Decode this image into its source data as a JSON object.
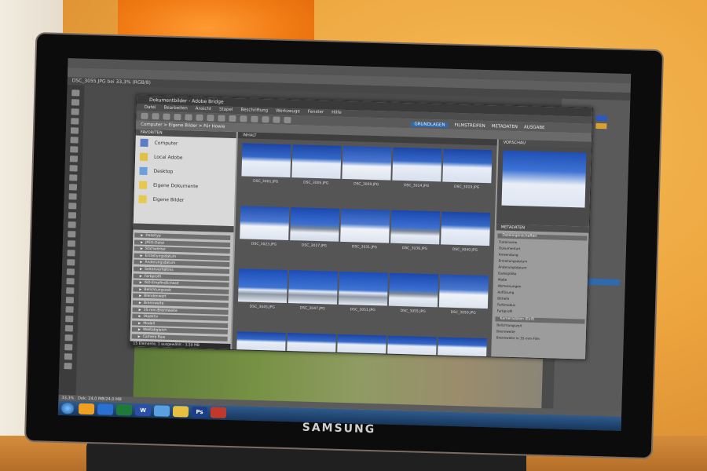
{
  "monitor": {
    "brand": "SAMSUNG"
  },
  "bridge": {
    "title": "Dokumentbilder - Adobe Bridge",
    "menu": [
      "Datei",
      "Bearbeiten",
      "Ansicht",
      "Stapel",
      "Beschriftung",
      "Werkzeuge",
      "Fenster",
      "Hilfe"
    ],
    "path": "Computer > Eigene Bilder > Für Howie",
    "workspaces": [
      {
        "label": "GRUNDLAGEN",
        "active": true
      },
      {
        "label": "FILMSTREIFEN",
        "active": false
      },
      {
        "label": "METADATEN",
        "active": false
      },
      {
        "label": "AUSGABE",
        "active": false
      }
    ],
    "favorites_tab": "FAVORITEN",
    "favorites": [
      "Computer",
      "Local Adobe",
      "Desktop",
      "Eigene Dokumente",
      "Eigene Bilder"
    ],
    "filter_tabs": [
      "FILTER",
      "SAMMLUNGEN",
      "EXPORTIEREN"
    ],
    "filter_items": [
      "Dateityp",
      "JPEG-Datei",
      "Stichwörter",
      "Erstellungsdatum",
      "Änderungsdatum",
      "Seitenverhältnis",
      "Farbprofil",
      "ISO-Empfindlichkeit",
      "Belichtungszeit",
      "Blendenwert",
      "Brennweite",
      "35-mm-Brennweite",
      "Objektiv",
      "Modell",
      "Weißabgleich",
      "Camera Raw"
    ],
    "content_tab": "INHALT",
    "thumbnails": [
      {
        "label": "DSC_3001.JPG",
        "type": "snow"
      },
      {
        "label": "DSC_3005.JPG",
        "type": "snow"
      },
      {
        "label": "DSC_3009.JPG",
        "type": "people"
      },
      {
        "label": "DSC_3014.JPG",
        "type": "snow"
      },
      {
        "label": "DSC_3019.JPG",
        "type": "snow"
      },
      {
        "label": "DSC_3023.JPG",
        "type": "people"
      },
      {
        "label": "DSC_3027.JPG",
        "type": "ridge"
      },
      {
        "label": "DSC_3031.JPG",
        "type": "people"
      },
      {
        "label": "DSC_3036.JPG",
        "type": "ridge"
      },
      {
        "label": "DSC_3040.JPG",
        "type": "snow"
      },
      {
        "label": "DSC_3045.JPG",
        "type": "mountains"
      },
      {
        "label": "DSC_3047.JPG",
        "type": "mountains"
      },
      {
        "label": "DSC_3051.JPG",
        "type": "mountains"
      },
      {
        "label": "DSC_3055.JPG",
        "type": "ridge"
      },
      {
        "label": "DSC_3059.JPG",
        "type": "people"
      }
    ],
    "preview_tab": "VORSCHAU",
    "metadata_tab": "METADATEN",
    "metadata_head_file": "Dateieigenschaften",
    "metadata_rows": [
      "Dateiname",
      "Dokumentart",
      "Anwendung",
      "Erstellungsdatum",
      "Änderungsdatum",
      "Dateigröße",
      "Maße",
      "Abmessungen",
      "Auflösung",
      "Bittiefe",
      "Farbmodus",
      "Farbprofil"
    ],
    "metadata_head_camera": "Kameradaten (Exif)",
    "camera_rows": [
      "Belichtungszeit",
      "Brennweite",
      "Brennweite in 35-mm-Film"
    ],
    "status": "15 Elemente, 1 ausgewählt - 3,59 MB"
  },
  "photoshop": {
    "doc_tab": "DSC_3055.JPG bei 33,3% (RGB/8)",
    "zoom": "33,3%",
    "status": "Dok: 24,0 MB/24,0 MB"
  },
  "taskbar": {
    "buttons": [
      "",
      "",
      "",
      "W",
      "",
      "",
      "Ps",
      ""
    ]
  },
  "colors": {
    "wall": "#eda53f",
    "curtain": "#f07a14",
    "bridge_bg": "#9a9a9a",
    "win7_taskbar": "#1d4778"
  }
}
